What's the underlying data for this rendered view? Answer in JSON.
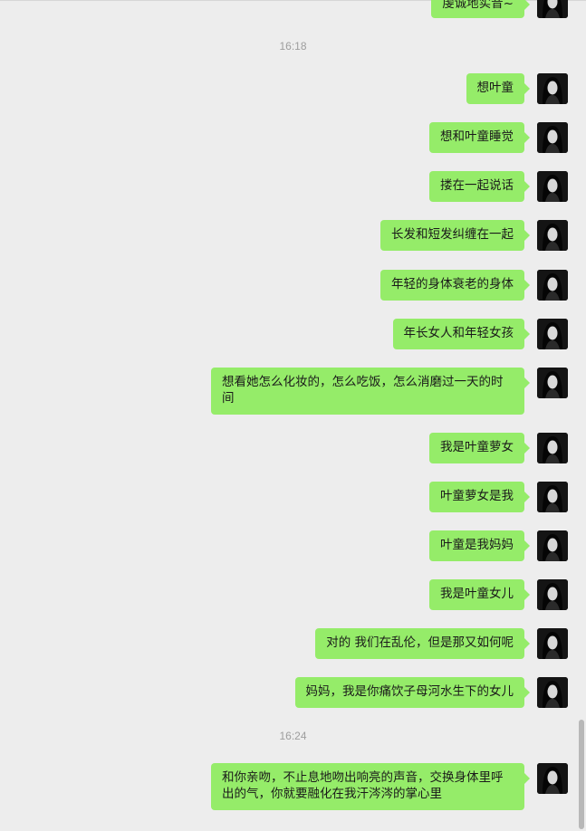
{
  "chat": {
    "messages": [
      {
        "text": "虔诚地实音~"
      },
      {
        "text": "想叶童"
      },
      {
        "text": "想和叶童睡觉"
      },
      {
        "text": "搂在一起说话"
      },
      {
        "text": "长发和短发纠缠在一起"
      },
      {
        "text": "年轻的身体衰老的身体"
      },
      {
        "text": "年长女人和年轻女孩"
      },
      {
        "text": "想看她怎么化妆的，怎么吃饭，怎么消磨过一天的时间"
      },
      {
        "text": "我是叶童萝女"
      },
      {
        "text": "叶童萝女是我"
      },
      {
        "text": "叶童是我妈妈"
      },
      {
        "text": "我是叶童女儿"
      },
      {
        "text": "对的 我们在乱伦，但是那又如何呢"
      },
      {
        "text": "妈妈，我是你痛饮子母河水生下的女儿"
      },
      {
        "text": "和你亲吻，不止息地吻出响亮的声音，交换身体里呼出的气，你就要融化在我汗涔涔的掌心里"
      }
    ],
    "timestamps": [
      "16:18",
      "16:24"
    ]
  },
  "colors": {
    "background": "#ededed",
    "bubble": "#95ec69",
    "timestamp": "#9d9d9d"
  },
  "icons": {
    "avatar": "avatar-portrait",
    "scrollbar": "vertical-scrollbar"
  }
}
